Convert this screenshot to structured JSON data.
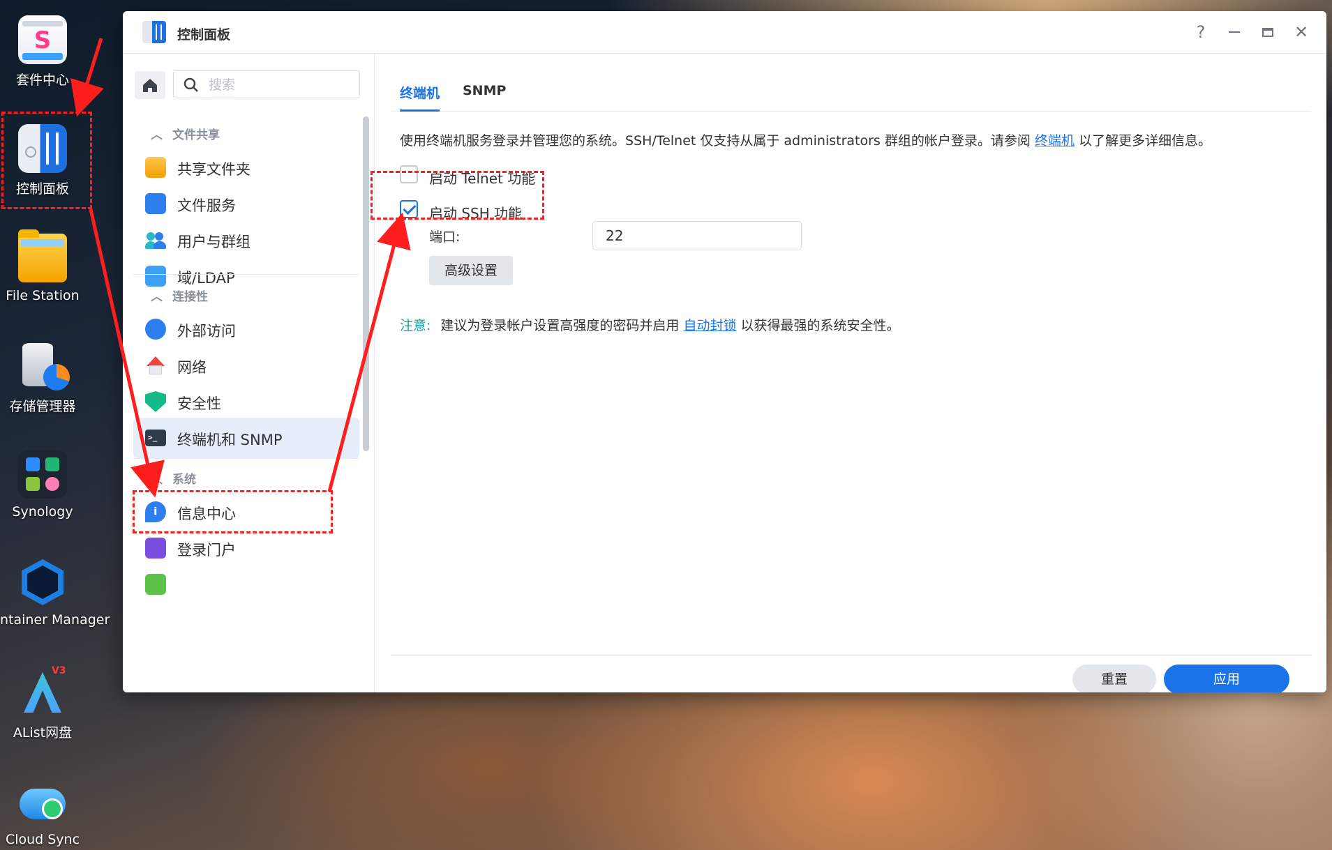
{
  "desktop": {
    "icons": [
      {
        "label": "套件中心",
        "icon": "package-center-icon"
      },
      {
        "label": "控制面板",
        "icon": "control-panel-icon"
      },
      {
        "label": "File Station",
        "icon": "folder-icon"
      },
      {
        "label": "存储管理器",
        "icon": "storage-manager-icon"
      },
      {
        "label": "Synology",
        "icon": "synology-apps-icon"
      },
      {
        "label": "ntainer Manager",
        "icon": "container-manager-icon"
      },
      {
        "label": "AList网盘",
        "icon": "alist-icon"
      },
      {
        "label": "Cloud Sync",
        "icon": "cloud-sync-icon"
      }
    ]
  },
  "window": {
    "title": "控制面板",
    "controls": {
      "help": "?",
      "minimize": "—",
      "maximize": "▭",
      "close": "✕"
    }
  },
  "sidebar": {
    "search_placeholder": "搜索",
    "groups": [
      {
        "label": "文件共享",
        "items": [
          "共享文件夹",
          "文件服务",
          "用户与群组",
          "域/LDAP"
        ]
      },
      {
        "label": "连接性",
        "items": [
          "外部访问",
          "网络",
          "安全性",
          "终端机和 SNMP"
        ]
      },
      {
        "label": "系统",
        "items": [
          "信息中心",
          "登录门户"
        ]
      }
    ],
    "active_item": "终端机和 SNMP"
  },
  "main": {
    "tabs": [
      "终端机",
      "SNMP"
    ],
    "active_tab": "终端机",
    "description_prefix": "使用终端机服务登录并管理您的系统。SSH/Telnet 仅支持从属于 administrators 群组的帐户登录。请参阅 ",
    "description_link": "终端机",
    "description_suffix": " 以了解更多详细信息。",
    "telnet_label": "启动 Telnet 功能",
    "telnet_checked": false,
    "ssh_label": "启动 SSH 功能",
    "ssh_checked": true,
    "port_label": "端口:",
    "port_value": "22",
    "advanced_button": "高级设置",
    "note_tag": "注意:",
    "note_prefix": "建议为登录帐户设置高强度的密码并启用 ",
    "note_link": "自动封锁",
    "note_suffix": " 以获得最强的系统安全性。",
    "reset_button": "重置",
    "apply_button": "应用"
  },
  "colors": {
    "accent": "#1a73e8",
    "annotation": "#ff1e1e",
    "note": "#19a0a0"
  }
}
